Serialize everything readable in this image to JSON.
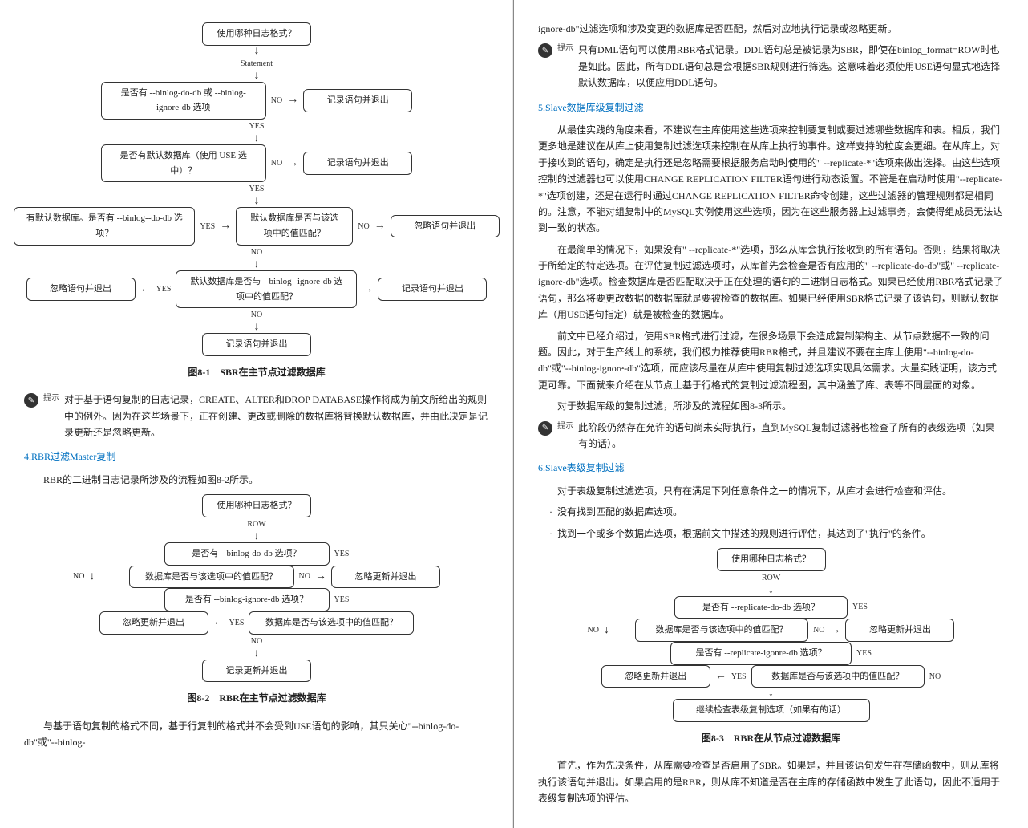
{
  "left": {
    "fc1": {
      "n1": "使用哪种日志格式？",
      "e1": "Statement",
      "n2": "是否有 --binlog-do-db 或 --binlog-ignore-db 选项",
      "e_no": "NO",
      "out_no2": "记录语句并退出",
      "e_yes": "YES",
      "n3": "是否有默认数据库（使用 USE 选中）？",
      "out_no3": "记录语句并退出",
      "n4": "有默认数据库。是否有 --binlog--do-db 选项？",
      "n5": "默认数据库是否与该选项中的值匹配？",
      "out_no5": "忽略语句并退出",
      "n6": "默认数据库是否与 --binlog--ignore-db 选项中的值匹配？",
      "out_yes6": "忽略语句并退出",
      "out_no4_yes": "记录语句并退出",
      "n7": "记录语句并退出"
    },
    "cap1": "图8-1　SBR在主节点过滤数据库",
    "note1": "对于基于语句复制的日志记录，CREATE、ALTER和DROP DATABASE操作将成为前文所给出的规则中的例外。因为在这些场景下，正在创建、更改或删除的数据库将替换默认数据库，并由此决定是记录更新还是忽略更新。",
    "h1": "4.RBR过滤Master复制",
    "p1": "RBR的二进制日志记录所涉及的流程如图8-2所示。",
    "fc2": {
      "n1": "使用哪种日志格式？",
      "e1": "ROW",
      "n2": "是否有 --binlog-do-db 选项？",
      "n3": "数据库是否与该选项中的值匹配？",
      "out_no3": "忽略更新并退出",
      "n4": "是否有 --binlog-ignore-db 选项？",
      "n5": "数据库是否与该选项中的值匹配？",
      "out_yes5": "忽略更新并退出",
      "n6": "记录更新并退出",
      "yes": "YES",
      "no": "NO"
    },
    "cap2": "图8-2　RBR在主节点过滤数据库",
    "p_last": "与基于语句复制的格式不同，基于行复制的格式并不会受到USE语句的影响，其只关心\"--binlog-do-db\"或\"--binlog-"
  },
  "right": {
    "p0": "ignore-db\"过滤选项和涉及变更的数据库是否匹配，然后对应地执行记录或忽略更新。",
    "note2": "只有DML语句可以使用RBR格式记录。DDL语句总是被记录为SBR，即使在binlog_format=ROW时也是如此。因此，所有DDL语句总是会根据SBR规则进行筛选。这意味着必须使用USE语句显式地选择默认数据库，以便应用DDL语句。",
    "h2": "5.Slave数据库级复制过滤",
    "p1": "从最佳实践的角度来看，不建议在主库使用这些选项来控制要复制或要过滤哪些数据库和表。相反，我们更多地是建议在从库上使用复制过滤选项来控制在从库上执行的事件。这样支持的粒度会更细。在从库上，对于接收到的语句，确定是执行还是忽略需要根据服务启动时使用的\" --replicate-*\"选项来做出选择。由这些选项控制的过滤器也可以使用CHANGE REPLICATION FILTER语句进行动态设置。不管是在启动时使用\"--replicate-*\"选项创建，还是在运行时通过CHANGE REPLICATION FILTER命令创建，这些过滤器的管理规则都是相同的。注意，不能对组复制中的MySQL实例使用这些选项，因为在这些服务器上过滤事务，会使得组成员无法达到一致的状态。",
    "p2": "在最简单的情况下，如果没有\" --replicate-*\"选项，那么从库会执行接收到的所有语句。否则，结果将取决于所给定的特定选项。在评估复制过滤选项时，从库首先会检查是否有应用的\" --replicate-do-db\"或\" --replicate-ignore-db\"选项。检查数据库是否匹配取决于正在处理的语句的二进制日志格式。如果已经使用RBR格式记录了语句，那么将要更改数据的数据库就是要被检查的数据库。如果已经使用SBR格式记录了该语句，则默认数据库（用USE语句指定）就是被检查的数据库。",
    "p3": "前文中已经介绍过，使用SBR格式进行过滤，在很多场景下会造成复制架构主、从节点数据不一致的问题。因此，对于生产线上的系统，我们极力推荐使用RBR格式，并且建议不要在主库上使用\"--binlog-do-db\"或\"--binlog-ignore-db\"选项，而应该尽量在从库中使用复制过滤选项实现具体需求。大量实践证明，该方式更可靠。下面就来介绍在从节点上基于行格式的复制过滤流程图，其中涵盖了库、表等不同层面的对象。",
    "p4": "对于数据库级的复制过滤，所涉及的流程如图8-3所示。",
    "note3": "此阶段仍然存在允许的语句尚未实际执行，直到MySQL复制过滤器也检查了所有的表级选项（如果有的话）。",
    "h3": "6.Slave表级复制过滤",
    "p5": "对于表级复制过滤选项，只有在满足下列任意条件之一的情况下，从库才会进行检查和评估。",
    "li1": "没有找到匹配的数据库选项。",
    "li2": "找到一个或多个数据库选项，根据前文中描述的规则进行评估，其达到了\"执行\"的条件。",
    "fc3": {
      "n1": "使用哪种日志格式？",
      "e1": "ROW",
      "n2": "是否有 --replicate-do-db 选项？",
      "n3": "数据库是否与该选项中的值匹配？",
      "out_no3": "忽略更新并退出",
      "n4": "是否有 --replicate-igonre-db 选项？",
      "n5": "数据库是否与该选项中的值匹配？",
      "out_yes5": "忽略更新并退出",
      "n6": "继续检查表级复制选项（如果有的话）",
      "yes": "YES",
      "no": "NO"
    },
    "cap3": "图8-3　RBR在从节点过滤数据库",
    "p6": "首先，作为先决条件，从库需要检查是否启用了SBR。如果是，并且该语句发生在存储函数中，则从库将执行该语句并退出。如果启用的是RBR，则从库不知道是否在主库的存储函数中发生了此语句，因此不适用于表级复制选项的评估。"
  },
  "labels": {
    "yes": "YES",
    "no": "NO",
    "tip": "提示"
  }
}
